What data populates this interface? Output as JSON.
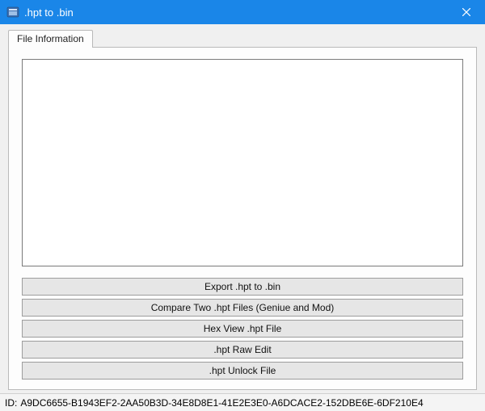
{
  "window": {
    "title": ".hpt to .bin"
  },
  "tabs": {
    "file_info": "File Information"
  },
  "text_area": {
    "value": ""
  },
  "buttons": {
    "export": "Export .hpt to .bin",
    "compare": "Compare Two .hpt Files (Geniue and Mod)",
    "hexview": "Hex View .hpt File",
    "rawedit": ".hpt Raw Edit",
    "unlock": ".hpt Unlock File"
  },
  "status": {
    "id_label": "ID:",
    "id_value": "A9DC6655-B1943EF2-2AA50B3D-34E8D8E1-41E2E3E0-A6DCACE2-152DBE6E-6DF210E4"
  }
}
